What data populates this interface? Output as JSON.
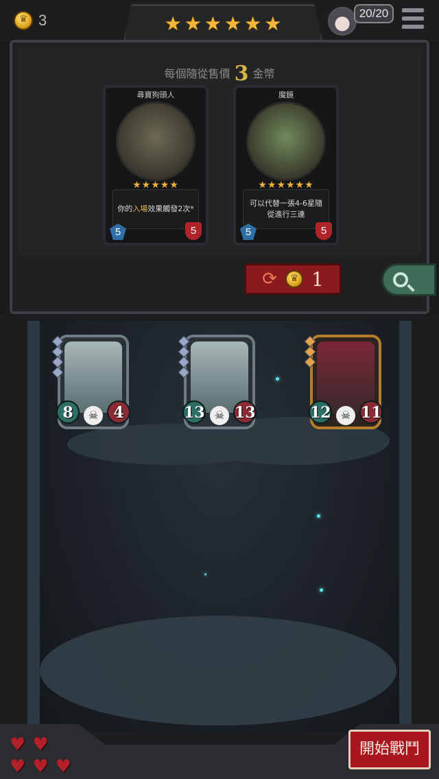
{
  "hud": {
    "coins": "3",
    "tavern_stars": [
      "★",
      "★",
      "★",
      "★",
      "★",
      "★"
    ],
    "health_display": "20/20",
    "menu_icon": "hamburger-menu-icon"
  },
  "shop": {
    "price_prefix": "每個隨從售價",
    "price_value": "3",
    "price_suffix": "金幣",
    "cards": [
      {
        "name": "尋寶狗頭人",
        "stars": "★★★★★",
        "desc_before": "你的",
        "desc_highlight": "入場",
        "desc_after": "效果觸發2次*",
        "attack": "5",
        "health": "5"
      },
      {
        "name": "魔鏡",
        "stars": "★★★★★★",
        "desc": "可以代替一張4-6星隨從進行三連",
        "attack": "5",
        "health": "5"
      }
    ],
    "refresh_cost": "1"
  },
  "board": {
    "minions": [
      {
        "attack": "8",
        "health": "4",
        "tier": "silver"
      },
      {
        "attack": "13",
        "health": "13",
        "tier": "silver"
      },
      {
        "attack": "12",
        "health": "11",
        "tier": "gold"
      }
    ]
  },
  "footer": {
    "hearts_count": 5,
    "start_battle_label": "開始戰鬥"
  },
  "colors": {
    "accent_red": "#a9161e",
    "star_gold": "#f4b63a",
    "highlight_text": "#e5b84a"
  }
}
